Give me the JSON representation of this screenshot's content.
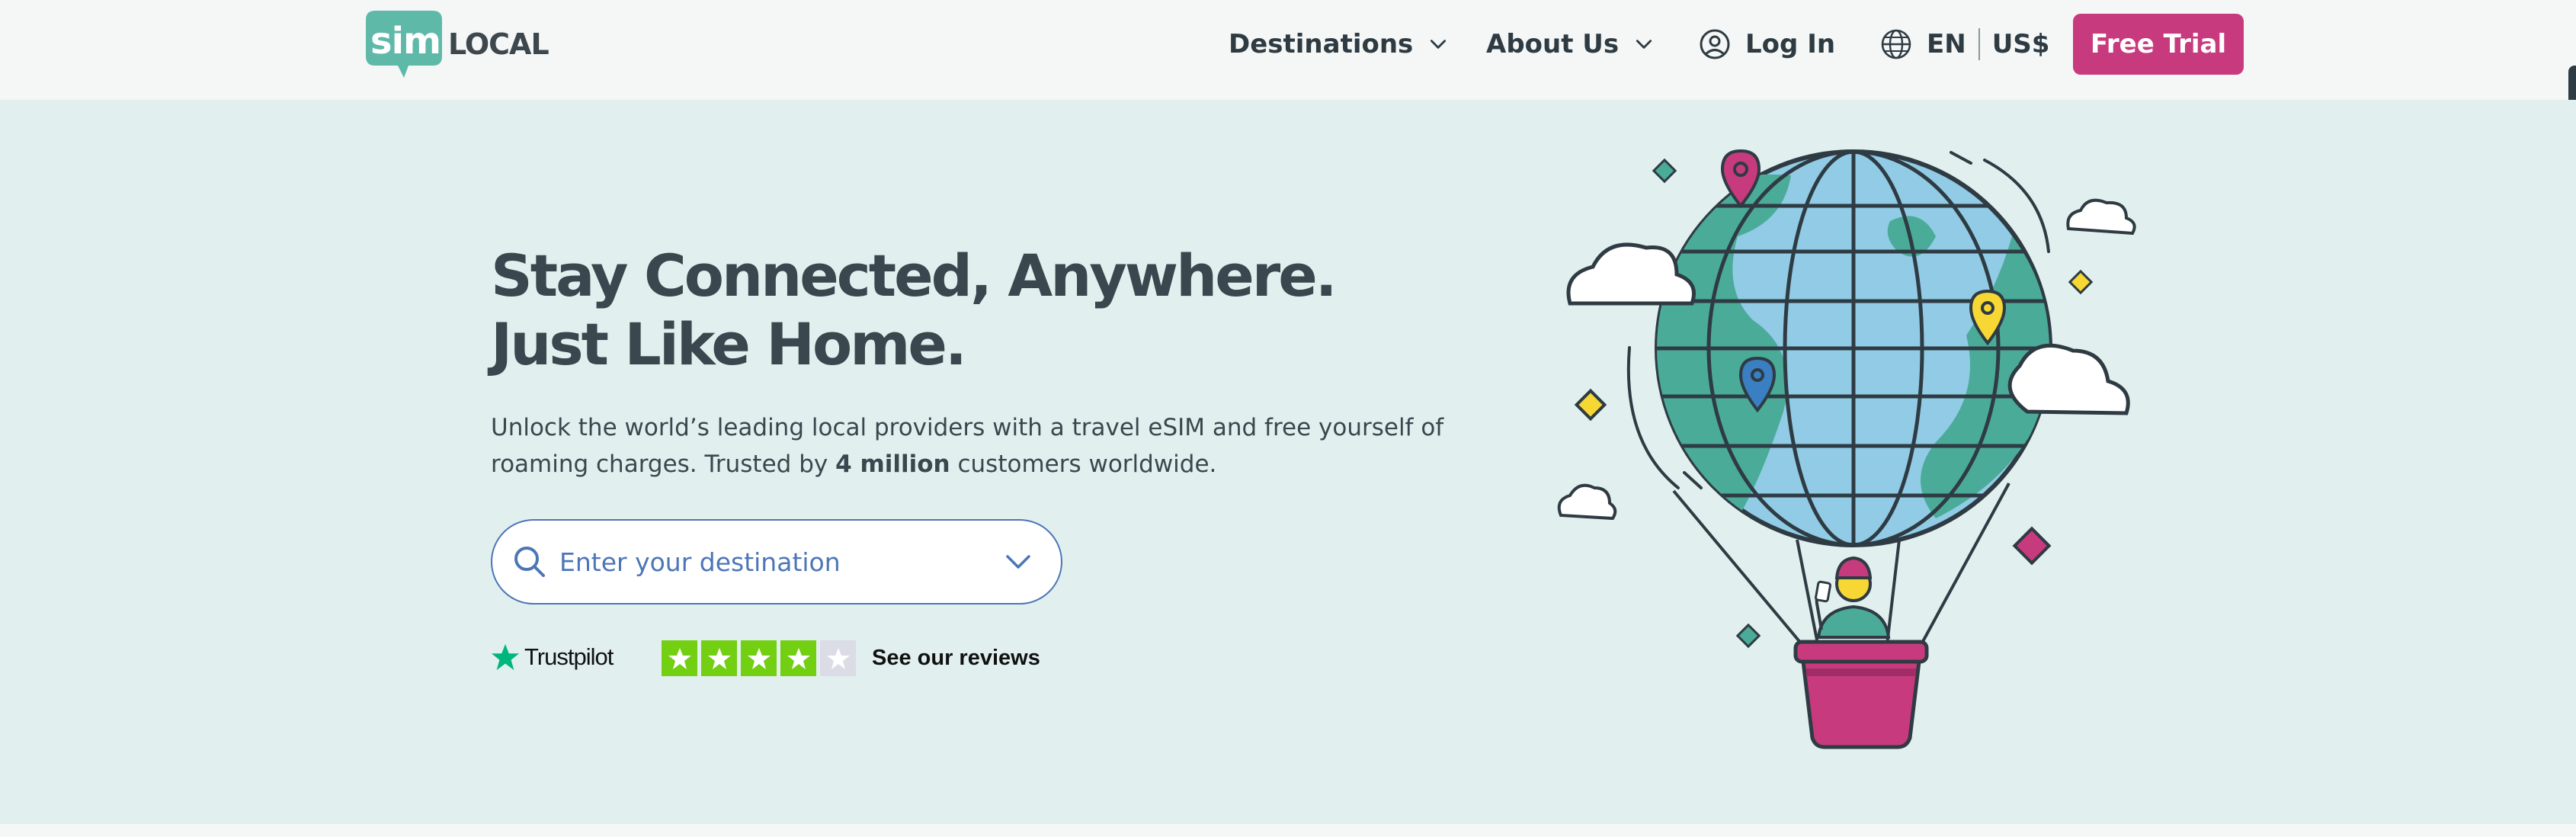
{
  "brand": {
    "logo_sim": "sim",
    "logo_local": "LOCAL",
    "color_teal": "#5fb9a9",
    "color_pink": "#c83a7e",
    "color_navy": "#2f3b43"
  },
  "nav": {
    "destinations": "Destinations",
    "about": "About Us",
    "login": "Log In",
    "language": "EN",
    "currency": "US$",
    "trial": "Free Trial"
  },
  "hero": {
    "title": "Stay Connected, Anywhere.  Just Like Home.",
    "subtitle_pre": "Unlock the world’s leading local providers with a travel eSIM and free yourself of roaming charges. Trusted by ",
    "subtitle_bold": "4 million",
    "subtitle_post": " customers worldwide.",
    "background": "#e1f0ef"
  },
  "search": {
    "placeholder": "Enter your destination"
  },
  "trustpilot": {
    "brand": "Trustpilot",
    "rating_stars": 4,
    "max_stars": 5,
    "reviews_link": "See our reviews",
    "star_color": "#73cf11"
  },
  "icons": {
    "destinations_chevron": "chevron-down-icon",
    "about_chevron": "chevron-down-icon",
    "login": "user-circle-icon",
    "language": "globe-icon",
    "search": "search-icon",
    "search_chevron": "chevron-down-icon",
    "trustpilot": "star-icon"
  }
}
